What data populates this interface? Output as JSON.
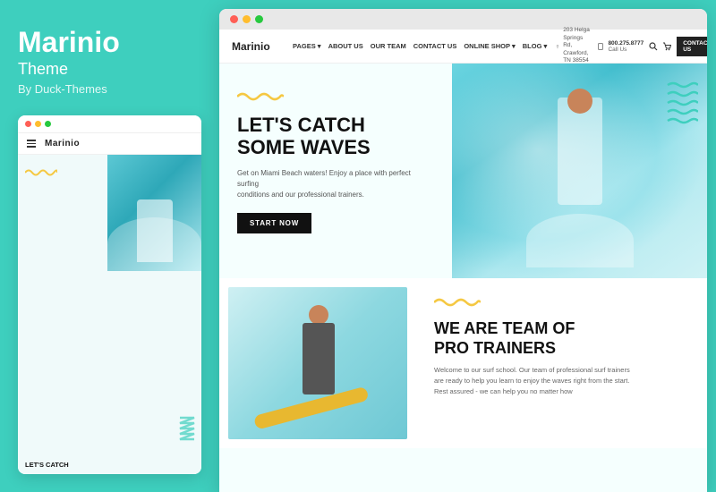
{
  "app": {
    "title": "Marinio",
    "subtitle": "Theme",
    "author": "By Duck-Themes"
  },
  "colors": {
    "teal": "#3ecfbe",
    "dark": "#111111",
    "yellow": "#f5c842",
    "white": "#ffffff",
    "dot_red": "#ff5f56",
    "dot_yellow": "#ffbd2e",
    "dot_green": "#27c93f"
  },
  "browser_dots": [
    "#ff5f56",
    "#ffbd2e",
    "#27c93f"
  ],
  "site": {
    "logo": "Marinio",
    "nav": {
      "links": [
        "PAGES ▾",
        "ABOUT US",
        "OUR TEAM",
        "CONTACT US",
        "ONLINE SHOP ▾",
        "BLOG ▾"
      ],
      "address": "203 Helga Springs Rd,\nCrawford, TN 38554",
      "phone": "800.275.8777\nCall Us",
      "contact_btn": "CONTACT US"
    },
    "hero": {
      "headline_line1": "LET'S CATCH",
      "headline_line2": "SOME WAVES",
      "description": "Get on Miami Beach waters! Enjoy a place with perfect surfing\nconditions and our professional trainers.",
      "cta_button": "START NOW"
    },
    "section2": {
      "title_line1": "WE ARE TEAM OF",
      "title_line2": "PRO TRAINERS",
      "description": "Welcome to our surf school. Our team of professional surf\ntrainers are ready to help you learn to enjoy the waves right\nfrom the start. Rest assured - we can help you no matter how"
    }
  },
  "mini_preview": {
    "logo": "Marinio",
    "headline": "LET'S CATCH"
  }
}
